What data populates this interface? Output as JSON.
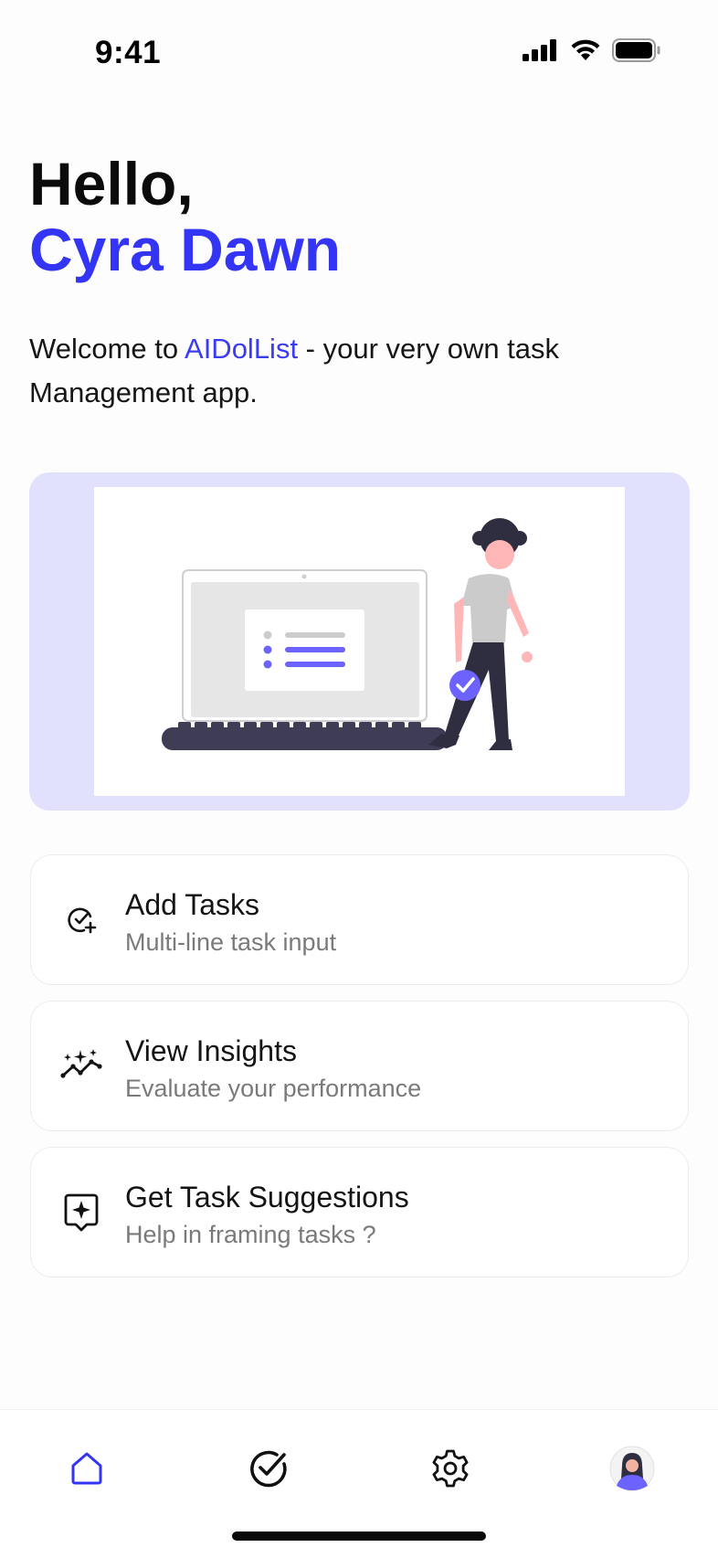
{
  "status_bar": {
    "time": "9:41",
    "icons": [
      "signal-icon",
      "wifi-icon",
      "battery-icon"
    ]
  },
  "greeting": {
    "hello": "Hello,",
    "name": "Cyra Dawn"
  },
  "welcome": {
    "prefix": "Welcome to ",
    "brand": "AIDolList",
    "suffix": " - your very own task Management app."
  },
  "colors": {
    "accent": "#3434f5",
    "hero_background": "#e1e1fd",
    "illustration_purple": "#6c63ff"
  },
  "hero": {
    "illustration": "person-with-laptop-checklist-illustration"
  },
  "cards": [
    {
      "title": "Add Tasks",
      "subtitle": "Multi-line task input",
      "icon": "check-circle-plus-icon"
    },
    {
      "title": "View Insights",
      "subtitle": "Evaluate your performance",
      "icon": "sparkle-trend-icon"
    },
    {
      "title": "Get Task Suggestions",
      "subtitle": "Help in framing tasks ?",
      "icon": "sparkle-message-icon"
    }
  ],
  "tabbar": {
    "tabs": [
      {
        "icon": "home-icon",
        "active": true
      },
      {
        "icon": "check-circle-icon",
        "active": false
      },
      {
        "icon": "gear-icon",
        "active": false
      },
      {
        "icon": "avatar",
        "active": false
      }
    ]
  }
}
